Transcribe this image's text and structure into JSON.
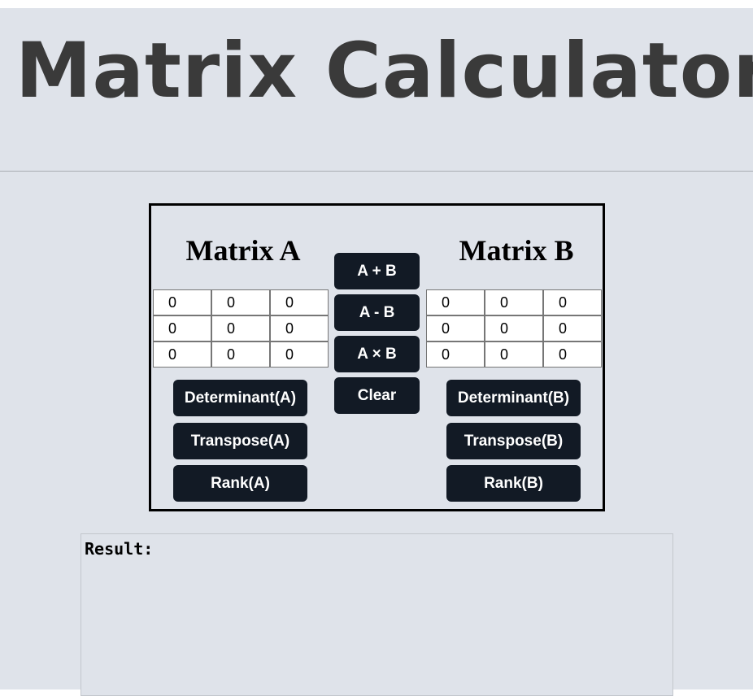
{
  "app": {
    "title": "Matrix Calculator"
  },
  "matrix_a": {
    "title": "Matrix A",
    "cells": [
      [
        "0",
        "0",
        "0"
      ],
      [
        "0",
        "0",
        "0"
      ],
      [
        "0",
        "0",
        "0"
      ]
    ],
    "buttons": {
      "determinant": "Determinant(A)",
      "transpose": "Transpose(A)",
      "rank": "Rank(A)"
    }
  },
  "matrix_b": {
    "title": "Matrix B",
    "cells": [
      [
        "0",
        "0",
        "0"
      ],
      [
        "0",
        "0",
        "0"
      ],
      [
        "0",
        "0",
        "0"
      ]
    ],
    "buttons": {
      "determinant": "Determinant(B)",
      "transpose": "Transpose(B)",
      "rank": "Rank(B)"
    }
  },
  "operations": {
    "add": "A + B",
    "subtract": "A - B",
    "multiply": "A × B",
    "clear": "Clear"
  },
  "result": {
    "label": "Result:"
  },
  "colors": {
    "page_background": "#dfe3ea",
    "button_background": "#121a25",
    "button_text": "#ffffff",
    "title_text": "#3a3a3a"
  }
}
